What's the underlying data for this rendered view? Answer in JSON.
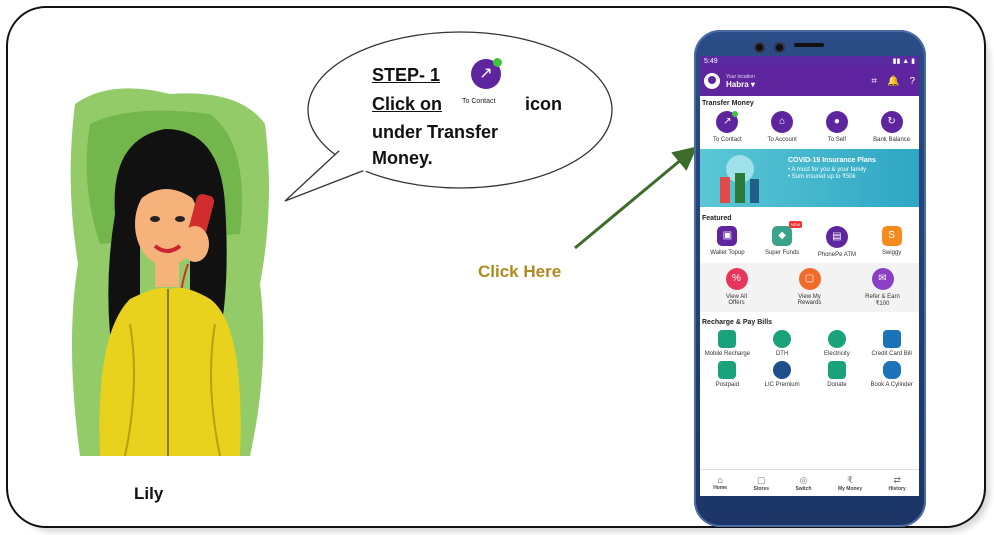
{
  "bubble": {
    "step": "STEP- 1",
    "line1a": "Click on",
    "icon_label": "To Contact",
    "line1b": "icon",
    "line2": "under Transfer",
    "line3": "Money."
  },
  "click_here": "Click Here",
  "person_name": "Lily",
  "phone": {
    "time": "5:49",
    "location_small": "Your location",
    "location": "Habra",
    "transfer_title": "Transfer Money",
    "transfer_items": [
      "To Contact",
      "To Account",
      "To Self",
      "Bank Balance"
    ],
    "banner": {
      "title": "COVID-19 Insurance Plans",
      "line1": "• A must for you & your family",
      "line2": "• Sum insured up to ₹50k"
    },
    "featured_title": "Featured",
    "featured_items": [
      "Wallet Topup",
      "Super Funds",
      "PhonePe ATM",
      "Swiggy"
    ],
    "featured_badge": "NEW",
    "offers": [
      {
        "l1": "View All",
        "l2": "Offers"
      },
      {
        "l1": "View My",
        "l2": "Rewards"
      },
      {
        "l1": "Refer & Earn",
        "l2": "₹100"
      }
    ],
    "bills_title": "Recharge & Pay Bills",
    "bills_row1": [
      "Mobile Recharge",
      "DTH",
      "Electricity",
      "Credit Card Bill"
    ],
    "bills_row2": [
      "Postpaid",
      "LIC Premium",
      "Donate",
      "Book A Cylinder"
    ],
    "nav": [
      "Home",
      "Stores",
      "Switch",
      "My Money",
      "History"
    ]
  },
  "colors": {
    "brand": "#5f259f",
    "click_here": "#b08a1e",
    "arrow": "#3d6b2a"
  }
}
